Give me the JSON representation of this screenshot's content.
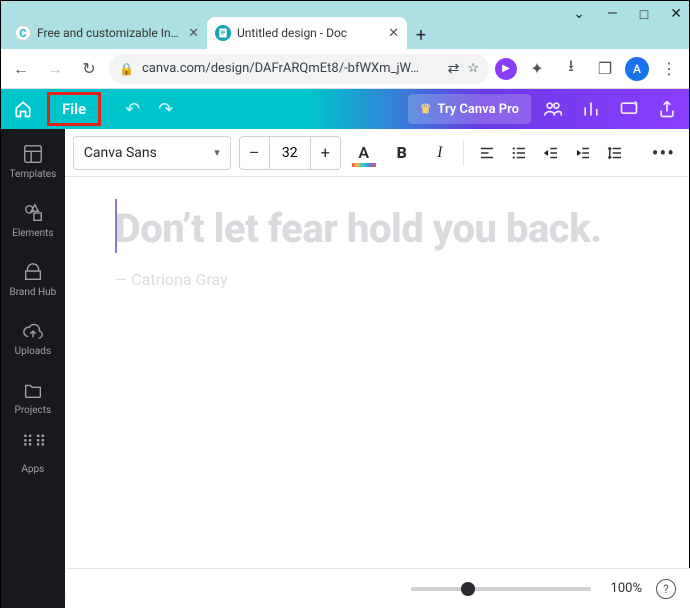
{
  "window": {
    "min": "—",
    "max": "□",
    "close": "✕",
    "dropdown": "⌄"
  },
  "tabs": {
    "inactive": {
      "title": "Free and customizable Instag",
      "close": "✕",
      "favicon": "C"
    },
    "active": {
      "title": "Untitled design - Doc",
      "close": "✕"
    },
    "new": "+"
  },
  "omnibox": {
    "back": "←",
    "forward": "→",
    "reload": "↻",
    "lock": "🔒",
    "url": "canva.com/design/DAFrARQmEt8/-bfWXm_jW…",
    "translate": "⇄",
    "star": "☆",
    "play": "▶",
    "ext": "✦",
    "dl": "⭳",
    "panel": "❐",
    "avatar": "A",
    "menu": "⋮"
  },
  "canva_top": {
    "file": "File",
    "try_pro": "Try Canva Pro",
    "crown": "♛"
  },
  "sidebar": {
    "items": [
      {
        "label": "Templates"
      },
      {
        "label": "Elements"
      },
      {
        "label": "Brand Hub"
      },
      {
        "label": "Uploads"
      },
      {
        "label": "Projects"
      },
      {
        "label": "Apps"
      }
    ]
  },
  "toolbar": {
    "font": "Canva Sans",
    "size_minus": "–",
    "size": "32",
    "size_plus": "+",
    "color_letter": "A",
    "bold": "B",
    "italic": "I",
    "more": "•••"
  },
  "document": {
    "quote": "Don’t let fear hold you back.",
    "author": "— Catriona Gray"
  },
  "bottom": {
    "zoom_pct": "100%",
    "help": "?"
  },
  "scroll": {
    "left": "◄",
    "right": "►"
  }
}
